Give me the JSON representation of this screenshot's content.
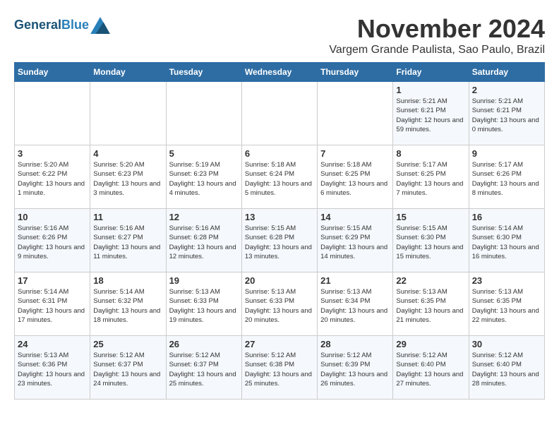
{
  "logo": {
    "line1": "General",
    "line2": "Blue"
  },
  "title": "November 2024",
  "location": "Vargem Grande Paulista, Sao Paulo, Brazil",
  "weekdays": [
    "Sunday",
    "Monday",
    "Tuesday",
    "Wednesday",
    "Thursday",
    "Friday",
    "Saturday"
  ],
  "weeks": [
    [
      {
        "day": "",
        "sunrise": "",
        "sunset": "",
        "daylight": ""
      },
      {
        "day": "",
        "sunrise": "",
        "sunset": "",
        "daylight": ""
      },
      {
        "day": "",
        "sunrise": "",
        "sunset": "",
        "daylight": ""
      },
      {
        "day": "",
        "sunrise": "",
        "sunset": "",
        "daylight": ""
      },
      {
        "day": "",
        "sunrise": "",
        "sunset": "",
        "daylight": ""
      },
      {
        "day": "1",
        "sunrise": "Sunrise: 5:21 AM",
        "sunset": "Sunset: 6:21 PM",
        "daylight": "Daylight: 12 hours and 59 minutes."
      },
      {
        "day": "2",
        "sunrise": "Sunrise: 5:21 AM",
        "sunset": "Sunset: 6:21 PM",
        "daylight": "Daylight: 13 hours and 0 minutes."
      }
    ],
    [
      {
        "day": "3",
        "sunrise": "Sunrise: 5:20 AM",
        "sunset": "Sunset: 6:22 PM",
        "daylight": "Daylight: 13 hours and 1 minute."
      },
      {
        "day": "4",
        "sunrise": "Sunrise: 5:20 AM",
        "sunset": "Sunset: 6:23 PM",
        "daylight": "Daylight: 13 hours and 3 minutes."
      },
      {
        "day": "5",
        "sunrise": "Sunrise: 5:19 AM",
        "sunset": "Sunset: 6:23 PM",
        "daylight": "Daylight: 13 hours and 4 minutes."
      },
      {
        "day": "6",
        "sunrise": "Sunrise: 5:18 AM",
        "sunset": "Sunset: 6:24 PM",
        "daylight": "Daylight: 13 hours and 5 minutes."
      },
      {
        "day": "7",
        "sunrise": "Sunrise: 5:18 AM",
        "sunset": "Sunset: 6:25 PM",
        "daylight": "Daylight: 13 hours and 6 minutes."
      },
      {
        "day": "8",
        "sunrise": "Sunrise: 5:17 AM",
        "sunset": "Sunset: 6:25 PM",
        "daylight": "Daylight: 13 hours and 7 minutes."
      },
      {
        "day": "9",
        "sunrise": "Sunrise: 5:17 AM",
        "sunset": "Sunset: 6:26 PM",
        "daylight": "Daylight: 13 hours and 8 minutes."
      }
    ],
    [
      {
        "day": "10",
        "sunrise": "Sunrise: 5:16 AM",
        "sunset": "Sunset: 6:26 PM",
        "daylight": "Daylight: 13 hours and 9 minutes."
      },
      {
        "day": "11",
        "sunrise": "Sunrise: 5:16 AM",
        "sunset": "Sunset: 6:27 PM",
        "daylight": "Daylight: 13 hours and 11 minutes."
      },
      {
        "day": "12",
        "sunrise": "Sunrise: 5:16 AM",
        "sunset": "Sunset: 6:28 PM",
        "daylight": "Daylight: 13 hours and 12 minutes."
      },
      {
        "day": "13",
        "sunrise": "Sunrise: 5:15 AM",
        "sunset": "Sunset: 6:28 PM",
        "daylight": "Daylight: 13 hours and 13 minutes."
      },
      {
        "day": "14",
        "sunrise": "Sunrise: 5:15 AM",
        "sunset": "Sunset: 6:29 PM",
        "daylight": "Daylight: 13 hours and 14 minutes."
      },
      {
        "day": "15",
        "sunrise": "Sunrise: 5:15 AM",
        "sunset": "Sunset: 6:30 PM",
        "daylight": "Daylight: 13 hours and 15 minutes."
      },
      {
        "day": "16",
        "sunrise": "Sunrise: 5:14 AM",
        "sunset": "Sunset: 6:30 PM",
        "daylight": "Daylight: 13 hours and 16 minutes."
      }
    ],
    [
      {
        "day": "17",
        "sunrise": "Sunrise: 5:14 AM",
        "sunset": "Sunset: 6:31 PM",
        "daylight": "Daylight: 13 hours and 17 minutes."
      },
      {
        "day": "18",
        "sunrise": "Sunrise: 5:14 AM",
        "sunset": "Sunset: 6:32 PM",
        "daylight": "Daylight: 13 hours and 18 minutes."
      },
      {
        "day": "19",
        "sunrise": "Sunrise: 5:13 AM",
        "sunset": "Sunset: 6:33 PM",
        "daylight": "Daylight: 13 hours and 19 minutes."
      },
      {
        "day": "20",
        "sunrise": "Sunrise: 5:13 AM",
        "sunset": "Sunset: 6:33 PM",
        "daylight": "Daylight: 13 hours and 20 minutes."
      },
      {
        "day": "21",
        "sunrise": "Sunrise: 5:13 AM",
        "sunset": "Sunset: 6:34 PM",
        "daylight": "Daylight: 13 hours and 20 minutes."
      },
      {
        "day": "22",
        "sunrise": "Sunrise: 5:13 AM",
        "sunset": "Sunset: 6:35 PM",
        "daylight": "Daylight: 13 hours and 21 minutes."
      },
      {
        "day": "23",
        "sunrise": "Sunrise: 5:13 AM",
        "sunset": "Sunset: 6:35 PM",
        "daylight": "Daylight: 13 hours and 22 minutes."
      }
    ],
    [
      {
        "day": "24",
        "sunrise": "Sunrise: 5:13 AM",
        "sunset": "Sunset: 6:36 PM",
        "daylight": "Daylight: 13 hours and 23 minutes."
      },
      {
        "day": "25",
        "sunrise": "Sunrise: 5:12 AM",
        "sunset": "Sunset: 6:37 PM",
        "daylight": "Daylight: 13 hours and 24 minutes."
      },
      {
        "day": "26",
        "sunrise": "Sunrise: 5:12 AM",
        "sunset": "Sunset: 6:37 PM",
        "daylight": "Daylight: 13 hours and 25 minutes."
      },
      {
        "day": "27",
        "sunrise": "Sunrise: 5:12 AM",
        "sunset": "Sunset: 6:38 PM",
        "daylight": "Daylight: 13 hours and 25 minutes."
      },
      {
        "day": "28",
        "sunrise": "Sunrise: 5:12 AM",
        "sunset": "Sunset: 6:39 PM",
        "daylight": "Daylight: 13 hours and 26 minutes."
      },
      {
        "day": "29",
        "sunrise": "Sunrise: 5:12 AM",
        "sunset": "Sunset: 6:40 PM",
        "daylight": "Daylight: 13 hours and 27 minutes."
      },
      {
        "day": "30",
        "sunrise": "Sunrise: 5:12 AM",
        "sunset": "Sunset: 6:40 PM",
        "daylight": "Daylight: 13 hours and 28 minutes."
      }
    ]
  ]
}
